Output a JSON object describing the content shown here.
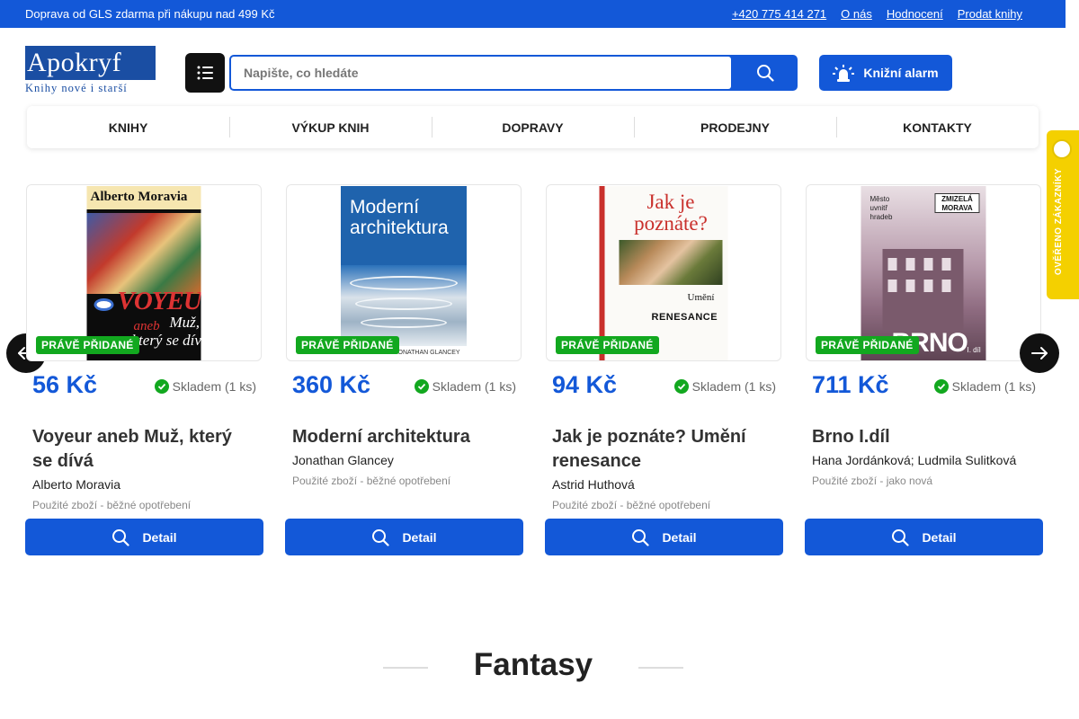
{
  "topbar": {
    "shipping": "Doprava od GLS zdarma při nákupu nad 499 Kč",
    "links": [
      "+420 775 414 271",
      "O nás",
      "Hodnocení",
      "Prodat knihy"
    ]
  },
  "header": {
    "logo_text": "Apokryf",
    "logo_tagline": "Knihy nové i starší",
    "search_placeholder": "Napište, co hledáte",
    "alarm_label": "Knižní alarm"
  },
  "nav": [
    "KNIHY",
    "VÝKUP KNIH",
    "DOPRAVY",
    "PRODEJNY",
    "KONTAKTY"
  ],
  "verified_badge": "OVĚŘENO ZÁKAZNÍKY",
  "products": [
    {
      "badge": "PRÁVĚ PŘIDANÉ",
      "price": "56 Kč",
      "stock": "Skladem (1 ks)",
      "title": "Voyeur aneb Muž, který se dívá",
      "author": "Alberto Moravia",
      "condition": "Použité zboží - běžné opotřebení",
      "detail_label": "Detail",
      "cover_texts": [
        "Alberto Moravia",
        "VOYEUR",
        "aneb",
        "Muž,",
        "který se dívá"
      ]
    },
    {
      "badge": "PRÁVĚ PŘIDANÉ",
      "price": "360 Kč",
      "stock": "Skladem (1 ks)",
      "title": "Moderní architektura",
      "author": "Jonathan Glancey",
      "condition": "Použité zboží - běžné opotřebení",
      "detail_label": "Detail",
      "cover_texts": [
        "Moderní architektura",
        "JONATHAN GLANCEY"
      ]
    },
    {
      "badge": "PRÁVĚ PŘIDANÉ",
      "price": "94 Kč",
      "stock": "Skladem (1 ks)",
      "title": "Jak je poznáte? Umění renesance",
      "author": "Astrid Huthová",
      "condition": "Použité zboží - běžné opotřebení",
      "detail_label": "Detail",
      "cover_texts": [
        "Jak je poznáte?",
        "Umění",
        "RENESANCE"
      ]
    },
    {
      "badge": "PRÁVĚ PŘIDANÉ",
      "price": "711 Kč",
      "stock": "Skladem (1 ks)",
      "title": "Brno I.díl",
      "author": "Hana Jordánková; Ludmila Sulitková",
      "condition": "Použité zboží - jako nová",
      "detail_label": "Detail",
      "cover_texts": [
        "Město uvnitř hradeb",
        "ZMIZELÁ MORAVA",
        "BRNO",
        "I. díl"
      ]
    }
  ],
  "section_title": "Fantasy",
  "colors": {
    "primary": "#1358d8",
    "badge_green": "#12a81f",
    "verified_yellow": "#f4d000",
    "dark": "#111111"
  }
}
